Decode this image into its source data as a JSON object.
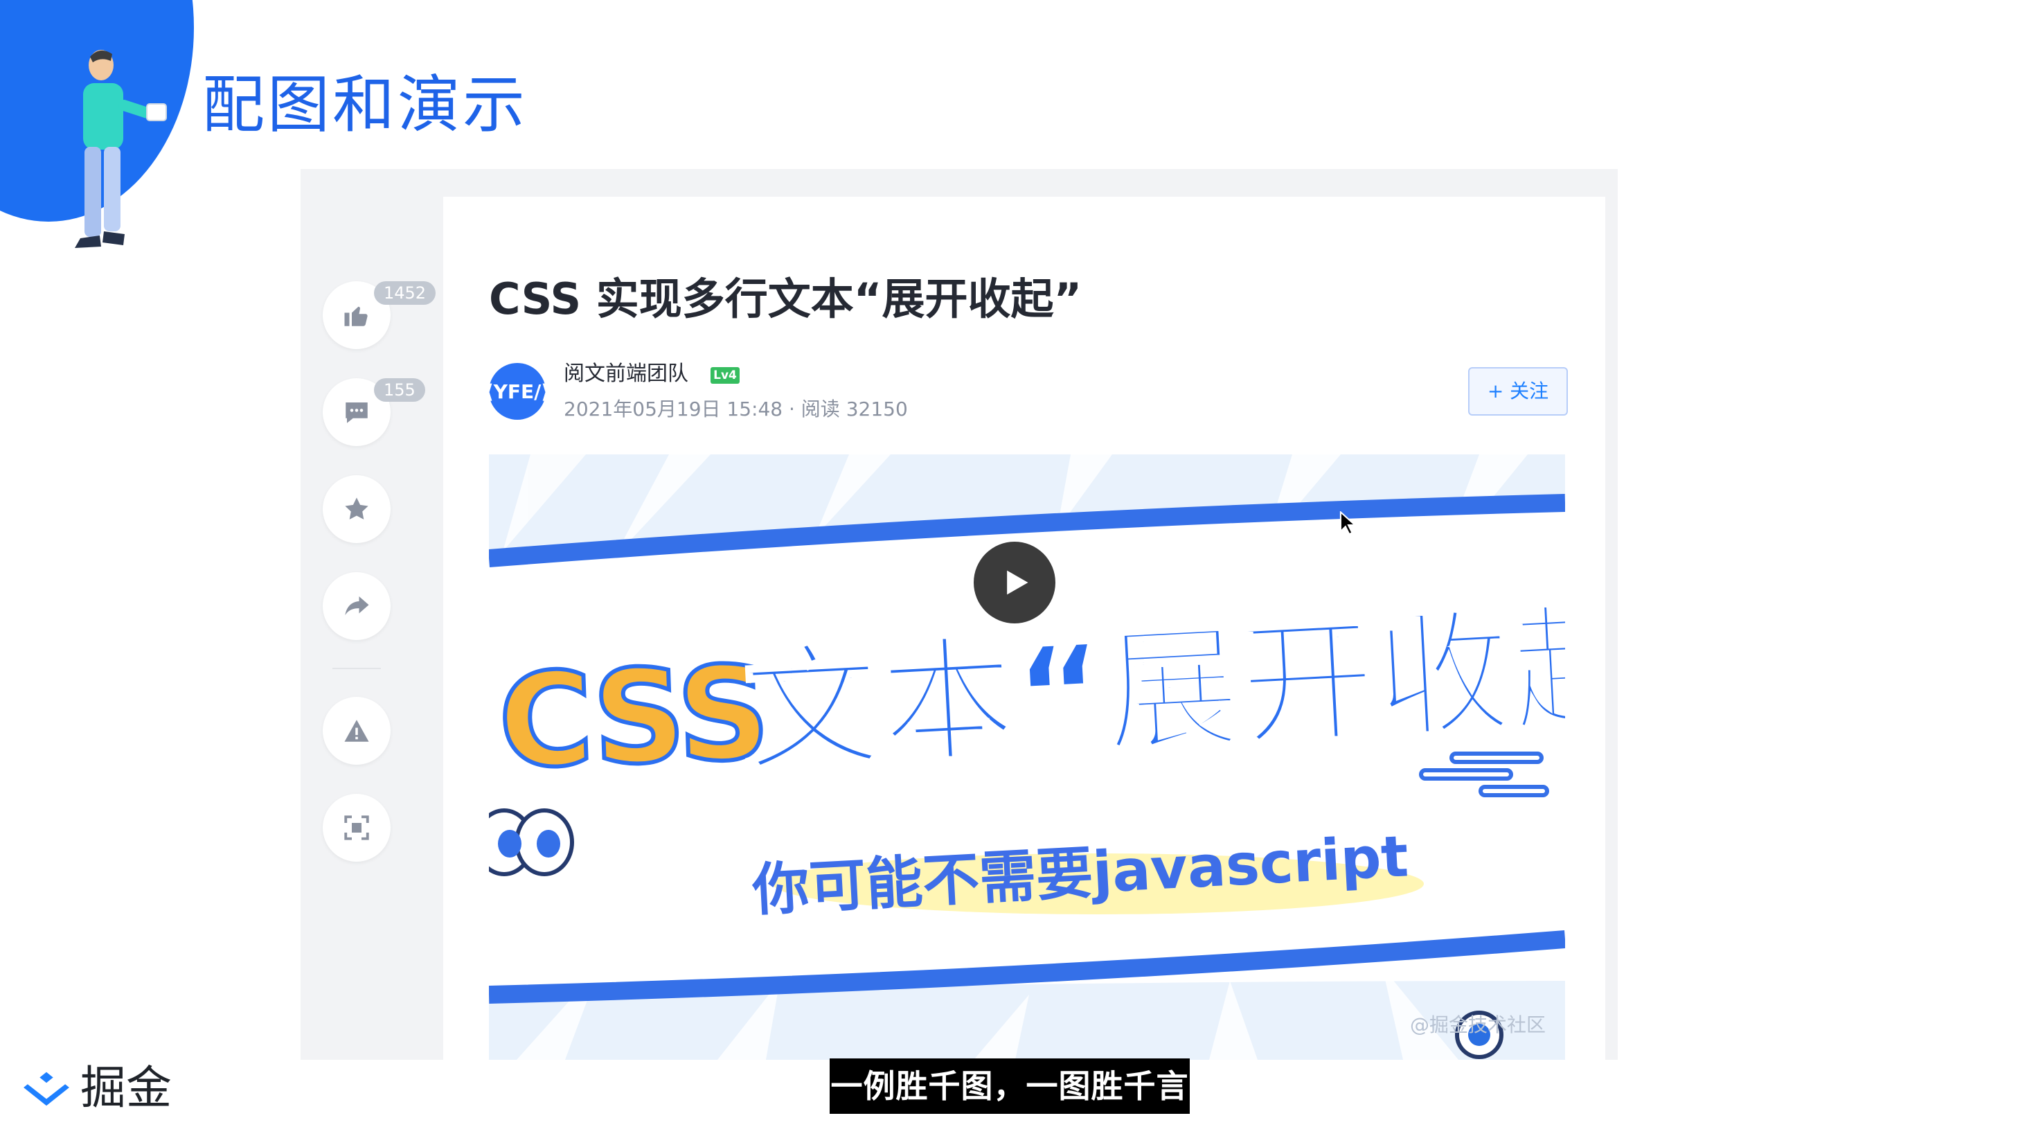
{
  "slide": {
    "title": "配图和演示",
    "accent_color": "#1e63e8",
    "caption": "一例胜千图，一图胜千言"
  },
  "brand": {
    "name": "掘金",
    "logo_icon": "juejin-logo-icon",
    "color": "#1e80ff"
  },
  "sidebar": {
    "buttons": [
      {
        "icon": "thumbs-up-icon",
        "badge": "1452"
      },
      {
        "icon": "comment-icon",
        "badge": "155"
      },
      {
        "icon": "star-icon",
        "badge": ""
      },
      {
        "icon": "share-icon",
        "badge": ""
      },
      {
        "icon": "warning-icon",
        "badge": ""
      },
      {
        "icon": "fullscreen-icon",
        "badge": ""
      }
    ]
  },
  "article": {
    "title": "CSS 实现多行文本“展开收起”",
    "author": "阅文前端团队",
    "author_avatar_text": "⟨YFE/⟩",
    "level_badge": "Lv4",
    "meta": "2021年05月19日 15:48 · 阅读 32150",
    "follow_label": "+ 关注"
  },
  "cover": {
    "title_prefix": "CSS",
    "title_main": "文本“展开收起”",
    "subtitle": "你可能不需要javascript",
    "watermark": "@掘金技术社区",
    "play_icon": "play-icon"
  }
}
